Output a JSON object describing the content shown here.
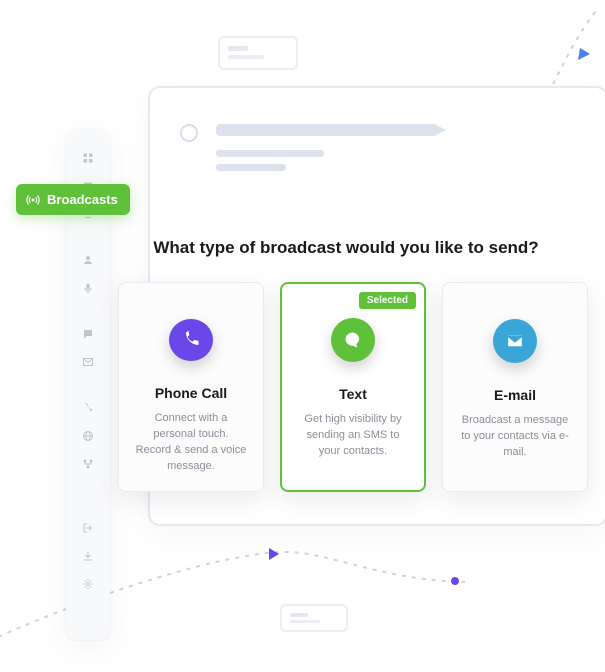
{
  "sidebar": {
    "active_label": "Broadcasts"
  },
  "heading": "What type of broadcast would you like to send?",
  "cards": [
    {
      "title": "Phone Call",
      "desc": "Connect with a personal touch. Record & send a voice message.",
      "selected": false
    },
    {
      "title": "Text",
      "desc": "Get high visibility by sending an SMS to your contacts.",
      "selected": true,
      "badge": "Selected"
    },
    {
      "title": "E-mail",
      "desc": "Broadcast a message to your contacts via e-mail.",
      "selected": false
    }
  ],
  "colors": {
    "accent_green": "#5ec139",
    "purple": "#6b46e8",
    "blue": "#3aa6d8"
  }
}
